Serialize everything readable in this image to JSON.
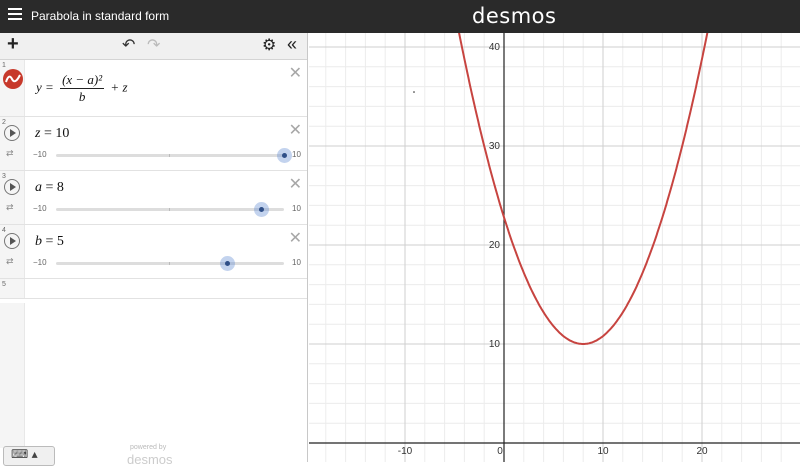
{
  "header": {
    "menu_icon": "hamburger-icon",
    "title": "Parabola in standard form",
    "brand": "desmos"
  },
  "toolbar": {
    "add_icon": "plus-icon",
    "undo_icon": "undo-icon",
    "redo_icon": "redo-icon",
    "settings_icon": "gear-icon",
    "collapse_icon": "double-chevron-left-icon"
  },
  "expressions": [
    {
      "num": "1",
      "lhs": "y",
      "numerator": "(x − a)²",
      "denominator": "b",
      "tail": "+ z"
    },
    {
      "num": "2",
      "var": "z",
      "value": "10",
      "min": "−10",
      "max": "10",
      "fraction": 1.0
    },
    {
      "num": "3",
      "var": "a",
      "value": "8",
      "min": "−10",
      "max": "10",
      "fraction": 0.9
    },
    {
      "num": "4",
      "var": "b",
      "value": "5",
      "min": "−10",
      "max": "10",
      "fraction": 0.75
    },
    {
      "num": "5"
    }
  ],
  "footer": {
    "keyboard_icon": "keyboard-icon",
    "powered_by": "powered by",
    "powered_brand": "desmos"
  },
  "graph": {
    "x_ticks": [
      "-10",
      "0",
      "10",
      "20"
    ],
    "y_ticks": [
      "10",
      "20",
      "30",
      "40"
    ],
    "curve_color": "#c74440"
  }
}
